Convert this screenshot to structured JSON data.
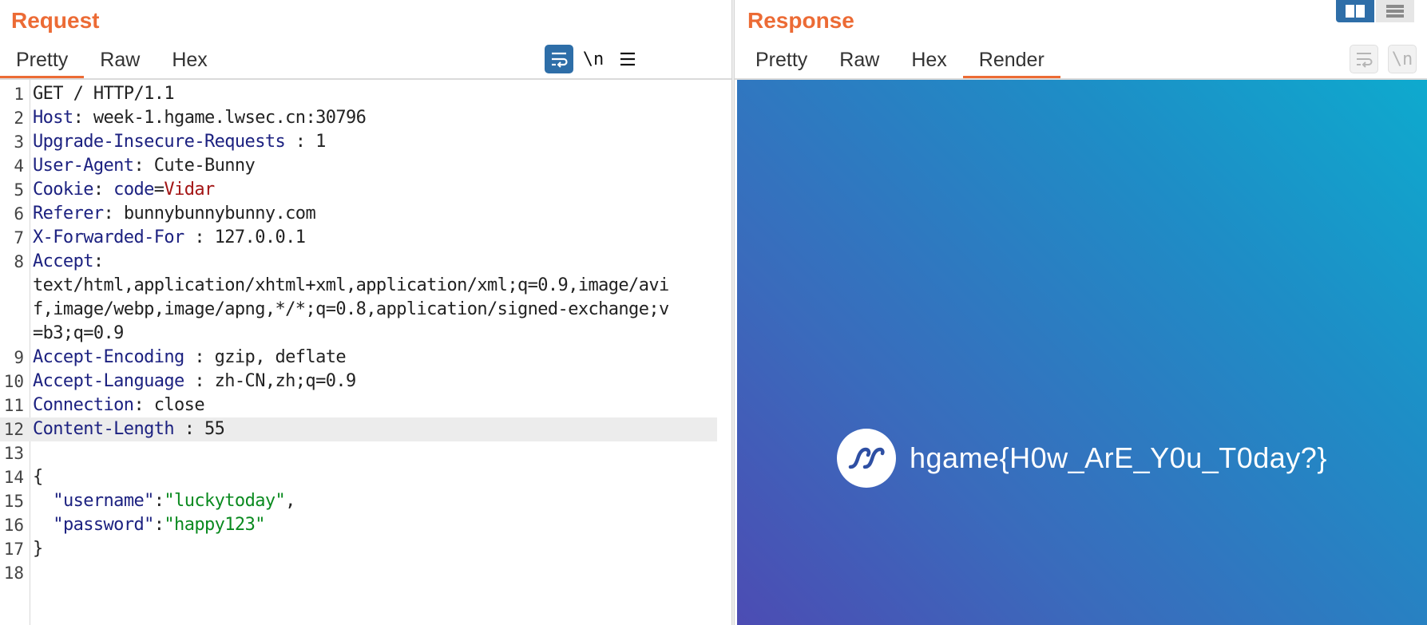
{
  "request": {
    "title": "Request",
    "tabs": [
      "Pretty",
      "Raw",
      "Hex"
    ],
    "active_tab": "Pretty",
    "toolbar": {
      "newline_label": "\\n"
    },
    "lines": [
      {
        "n": "1",
        "parts": [
          {
            "t": "v",
            "s": "GET / HTTP/1.1"
          }
        ]
      },
      {
        "n": "2",
        "parts": [
          {
            "t": "k",
            "s": "Host"
          },
          {
            "t": "sep",
            "s": ": "
          },
          {
            "t": "v",
            "s": "week-1.hgame.lwsec.cn:30796"
          }
        ]
      },
      {
        "n": "3",
        "parts": [
          {
            "t": "k",
            "s": "Upgrade-Insecure-Requests"
          },
          {
            "t": "sep",
            "s": " : "
          },
          {
            "t": "v",
            "s": "1"
          }
        ]
      },
      {
        "n": "4",
        "parts": [
          {
            "t": "k",
            "s": "User-Agent"
          },
          {
            "t": "sep",
            "s": ": "
          },
          {
            "t": "v",
            "s": "Cute-Bunny"
          }
        ]
      },
      {
        "n": "5",
        "parts": [
          {
            "t": "k",
            "s": "Cookie"
          },
          {
            "t": "sep",
            "s": ": "
          },
          {
            "t": "k",
            "s": "code"
          },
          {
            "t": "sep",
            "s": "="
          },
          {
            "t": "cv",
            "s": "Vidar"
          }
        ]
      },
      {
        "n": "6",
        "parts": [
          {
            "t": "k",
            "s": "Referer"
          },
          {
            "t": "sep",
            "s": ": "
          },
          {
            "t": "v",
            "s": "bunnybunnybunny.com"
          }
        ]
      },
      {
        "n": "7",
        "parts": [
          {
            "t": "k",
            "s": "X-Forwarded-For"
          },
          {
            "t": "sep",
            "s": " : "
          },
          {
            "t": "v",
            "s": "127.0.0.1"
          }
        ]
      },
      {
        "n": "8",
        "parts": [
          {
            "t": "k",
            "s": "Accept"
          },
          {
            "t": "sep",
            "s": ":"
          }
        ]
      },
      {
        "n": "",
        "parts": [
          {
            "t": "v",
            "s": "text/html,application/xhtml+xml,application/xml;q=0.9,image/avi"
          }
        ]
      },
      {
        "n": "",
        "parts": [
          {
            "t": "v",
            "s": "f,image/webp,image/apng,*/*;q=0.8,application/signed-exchange;v"
          }
        ]
      },
      {
        "n": "",
        "parts": [
          {
            "t": "v",
            "s": "=b3;q=0.9"
          }
        ]
      },
      {
        "n": "9",
        "parts": [
          {
            "t": "k",
            "s": "Accept-Encoding"
          },
          {
            "t": "sep",
            "s": " : "
          },
          {
            "t": "v",
            "s": "gzip, deflate"
          }
        ]
      },
      {
        "n": "10",
        "parts": [
          {
            "t": "k",
            "s": "Accept-Language"
          },
          {
            "t": "sep",
            "s": " : "
          },
          {
            "t": "v",
            "s": "zh-CN,zh;q=0.9"
          }
        ]
      },
      {
        "n": "11",
        "parts": [
          {
            "t": "k",
            "s": "Connection"
          },
          {
            "t": "sep",
            "s": ": "
          },
          {
            "t": "v",
            "s": "close"
          }
        ]
      },
      {
        "n": "12",
        "parts": [
          {
            "t": "k",
            "s": "Content-Length"
          },
          {
            "t": "sep",
            "s": " : "
          },
          {
            "t": "v",
            "s": "55"
          }
        ],
        "highlight": true
      },
      {
        "n": "13",
        "parts": []
      },
      {
        "n": "14",
        "parts": [
          {
            "t": "v",
            "s": "{"
          }
        ]
      },
      {
        "n": "15",
        "parts": [
          {
            "t": "v",
            "s": "  "
          },
          {
            "t": "jk",
            "s": "\"username\""
          },
          {
            "t": "sep",
            "s": ":"
          },
          {
            "t": "js",
            "s": "\"luckytoday\""
          },
          {
            "t": "sep",
            "s": ","
          }
        ]
      },
      {
        "n": "16",
        "parts": [
          {
            "t": "v",
            "s": "  "
          },
          {
            "t": "jk",
            "s": "\"password\""
          },
          {
            "t": "sep",
            "s": ":"
          },
          {
            "t": "js",
            "s": "\"happy123\""
          }
        ]
      },
      {
        "n": "17",
        "parts": [
          {
            "t": "v",
            "s": "}"
          }
        ]
      },
      {
        "n": "18",
        "parts": []
      }
    ]
  },
  "response": {
    "title": "Response",
    "tabs": [
      "Pretty",
      "Raw",
      "Hex",
      "Render"
    ],
    "active_tab": "Render",
    "toolbar": {
      "newline_label": "\\n"
    },
    "render": {
      "flag": "hgame{H0w_ArE_Y0u_T0day?}",
      "logo": "vidar-logo-icon",
      "gradient_colors": [
        "#0eaace",
        "#1e8dc6",
        "#3a6bbc",
        "#4c4cb3"
      ]
    }
  },
  "colors": {
    "accent": "#ec6b35",
    "header_key": "#1c2180",
    "cookie_value": "#a31515",
    "json_string": "#0a8a1f",
    "toggle_active": "#2e6ea8"
  },
  "icons": {
    "wrap": "word-wrap-icon",
    "menu": "hamburger-menu-icon",
    "layout_split": "split-columns-icon",
    "layout_stack": "stacked-rows-icon"
  }
}
